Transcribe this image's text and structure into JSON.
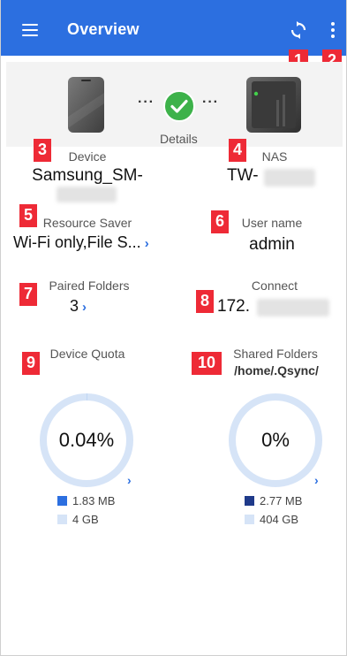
{
  "appbar": {
    "title": "Overview",
    "menu_icon": "hamburger-menu-icon",
    "sync_icon": "sync-icon",
    "more_icon": "more-vertical-icon",
    "color": "#2c6fe0"
  },
  "badges": [
    "1",
    "2",
    "3",
    "4",
    "5",
    "6",
    "7",
    "8",
    "9",
    "10"
  ],
  "connection": {
    "dots_left": "···",
    "dots_right": "···",
    "status_icon": "check-circle-icon",
    "status_color": "#3db24a",
    "details_label": "Details"
  },
  "device": {
    "label": "Device",
    "name": "Samsung_SM-"
  },
  "nas": {
    "label": "NAS",
    "name": "TW-"
  },
  "resource_saver": {
    "label": "Resource Saver",
    "value": "Wi-Fi only,File S..."
  },
  "user": {
    "label": "User name",
    "value": "admin"
  },
  "paired_folders": {
    "label": "Paired Folders",
    "value": "3"
  },
  "connect": {
    "label": "Connect",
    "value": "172."
  },
  "device_quota": {
    "label": "Device Quota",
    "percent_label": "0.04%",
    "fraction": 0.0004,
    "used": "1.83 MB",
    "total": "4 GB",
    "used_color": "#2c6fe0",
    "total_color": "#d6e4f7"
  },
  "shared_folders": {
    "label": "Shared Folders",
    "path": "/home/.Qsync/",
    "percent_label": "0%",
    "fraction": 0,
    "used": "2.77 MB",
    "total": "404 GB",
    "used_color": "#1f3a8a",
    "total_color": "#d6e4f7"
  }
}
